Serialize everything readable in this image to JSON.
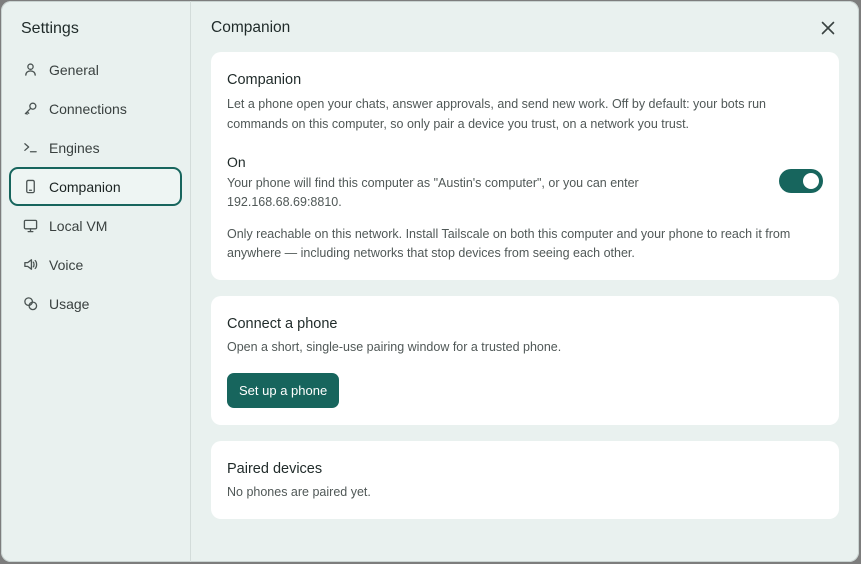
{
  "sidebar": {
    "title": "Settings",
    "items": [
      {
        "label": "General",
        "icon": "person-icon"
      },
      {
        "label": "Connections",
        "icon": "key-icon"
      },
      {
        "label": "Engines",
        "icon": "terminal-icon"
      },
      {
        "label": "Companion",
        "icon": "phone-icon",
        "active": true
      },
      {
        "label": "Local VM",
        "icon": "monitor-icon"
      },
      {
        "label": "Voice",
        "icon": "speaker-icon"
      },
      {
        "label": "Usage",
        "icon": "coins-icon"
      }
    ]
  },
  "main": {
    "title": "Companion",
    "companion_card": {
      "heading": "Companion",
      "description": "Let a phone open your chats, answer approvals, and send new work. Off by default: your bots run commands on this computer, so only pair a device you trust, on a network you trust.",
      "toggle_label": "On",
      "toggle_on": true,
      "toggle_detail": "Your phone will find this computer as \"Austin's computer\", or you can enter 192.168.68.69:8810.",
      "network_note": "Only reachable on this network. Install Tailscale on both this computer and your phone to reach it from anywhere — including networks that stop devices from seeing each other."
    },
    "connect_card": {
      "heading": "Connect a phone",
      "description": "Open a short, single-use pairing window for a trusted phone.",
      "button_label": "Set up a phone"
    },
    "paired_card": {
      "heading": "Paired devices",
      "empty_text": "No phones are paired yet."
    }
  },
  "colors": {
    "accent": "#17655d",
    "window_bg": "#e9f1ef",
    "card_bg": "#ffffff"
  }
}
